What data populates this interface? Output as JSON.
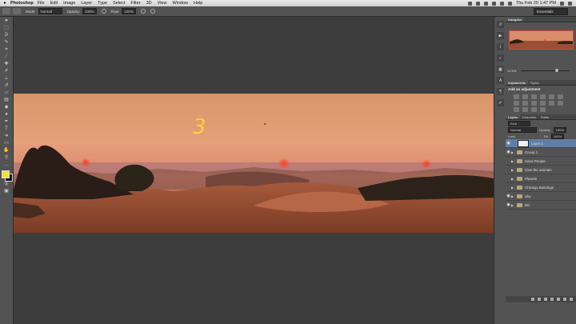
{
  "menubar": {
    "apple": "",
    "app_name": "Photoshop",
    "menus": [
      "File",
      "Edit",
      "Image",
      "Layer",
      "Type",
      "Select",
      "Filter",
      "3D",
      "View",
      "Window",
      "Help"
    ],
    "clock": "Thu Feb 20  1:47 PM"
  },
  "options_bar": {
    "mode_label": "Mode:",
    "mode_value": "Normal",
    "opacity_label": "Opacity:",
    "opacity_value": "100%",
    "flow_label": "Flow:",
    "flow_value": "100%",
    "workspace": "Essentials"
  },
  "navigator": {
    "tab": "Navigator",
    "zoom": "12.5%"
  },
  "adjustments": {
    "tabs": [
      "Adjustments",
      "Styles"
    ],
    "title": "Add an adjustment"
  },
  "layers": {
    "tabs": [
      "Layers",
      "Channels",
      "Paths"
    ],
    "kind": "Kind",
    "blend": "Normal",
    "opacity_label": "Opacity:",
    "opacity_value": "100%",
    "lock_label": "Lock:",
    "fill_label": "Fill:",
    "fill_value": "100%",
    "items": [
      {
        "name": "Layer 1",
        "type": "layer",
        "selected": true
      },
      {
        "name": "Group 1",
        "type": "group"
      },
      {
        "name": "Sand People",
        "type": "group"
      },
      {
        "name": "Give the animals",
        "type": "group"
      },
      {
        "name": "Planets",
        "type": "group"
      },
      {
        "name": "Chicago Buildings",
        "type": "group"
      },
      {
        "name": "Sky",
        "type": "group"
      },
      {
        "name": "BG",
        "type": "group"
      }
    ]
  },
  "canvas": {
    "annotation": "3"
  },
  "colors": {
    "foreground": "#f2e033",
    "background": "#111111",
    "selection": "#5f7fa8"
  }
}
